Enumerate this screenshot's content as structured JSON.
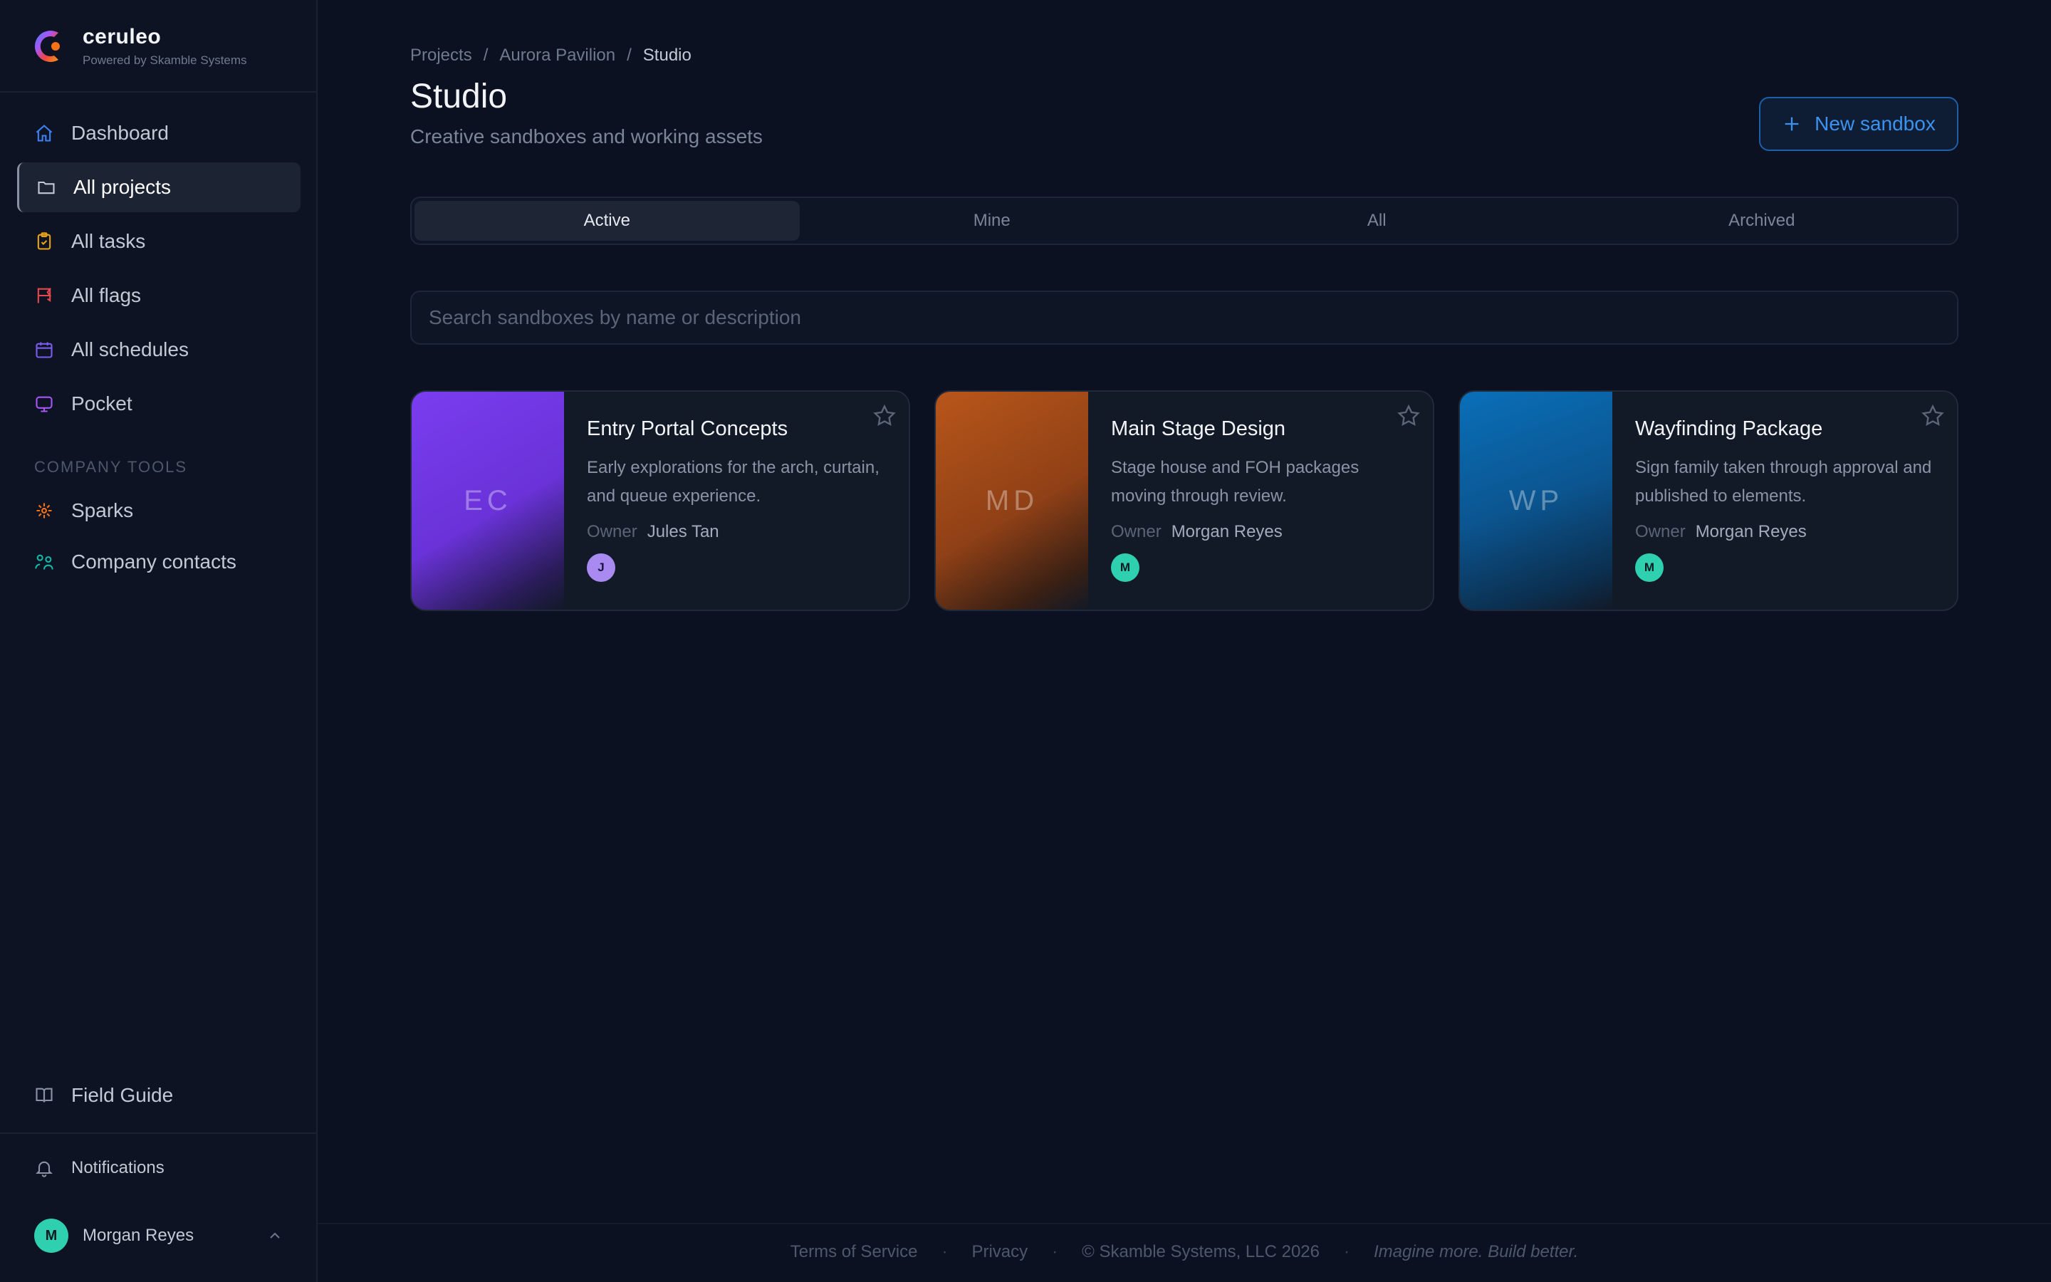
{
  "app": {
    "name": "ceruleo",
    "powered_by": "Powered by Skamble Systems"
  },
  "sidebar": {
    "items": [
      {
        "label": "Dashboard",
        "icon": "home-icon",
        "color": "#3b82f6"
      },
      {
        "label": "All projects",
        "icon": "folder-icon",
        "color": "#c3c9d4",
        "active": true
      },
      {
        "label": "All tasks",
        "icon": "clipboard-check-icon",
        "color": "#e8a317"
      },
      {
        "label": "All flags",
        "icon": "flag-icon",
        "color": "#e5484d"
      },
      {
        "label": "All schedules",
        "icon": "calendar-icon",
        "color": "#7c5cf0"
      },
      {
        "label": "Pocket",
        "icon": "pocket-icon",
        "color": "#a855f7"
      }
    ],
    "section_label": "COMPANY TOOLS",
    "tools": [
      {
        "label": "Sparks",
        "icon": "sparkle-icon",
        "color": "#f97316"
      },
      {
        "label": "Company contacts",
        "icon": "contacts-icon",
        "color": "#14b8a6"
      }
    ],
    "field_guide": "Field Guide",
    "notifications": "Notifications",
    "user": {
      "initial": "M",
      "name": "Morgan Reyes"
    }
  },
  "main": {
    "breadcrumb": [
      "Projects",
      "Aurora Pavilion",
      "Studio"
    ],
    "breadcrumb_sep": "/",
    "title": "Studio",
    "subtitle": "Creative sandboxes and working assets",
    "new_button": "New sandbox",
    "tabs": [
      "Active",
      "Mine",
      "All",
      "Archived"
    ],
    "active_tab": "Active",
    "search_placeholder": "Search sandboxes by name or description",
    "cards": [
      {
        "initials": "EC",
        "title": "Entry Portal Concepts",
        "description": "Early explorations for the arch, curtain, and queue experience.",
        "owner_label": "Owner",
        "owner": "Jules Tan",
        "avatar": "J",
        "accent": "#7a3df0"
      },
      {
        "initials": "MD",
        "title": "Main Stage Design",
        "description": "Stage house and FOH packages moving through review.",
        "owner_label": "Owner",
        "owner": "Morgan Reyes",
        "avatar": "M",
        "accent": "#b8561a"
      },
      {
        "initials": "WP",
        "title": "Wayfinding Package",
        "description": "Sign family taken through approval and published to elements.",
        "owner_label": "Owner",
        "owner": "Morgan Reyes",
        "avatar": "M",
        "accent": "#0a6fb8"
      }
    ]
  },
  "footer": {
    "terms": "Terms of Service",
    "privacy": "Privacy",
    "copyright": "© Skamble Systems, LLC 2026",
    "tagline": "Imagine more. Build better.",
    "sep": "·"
  }
}
